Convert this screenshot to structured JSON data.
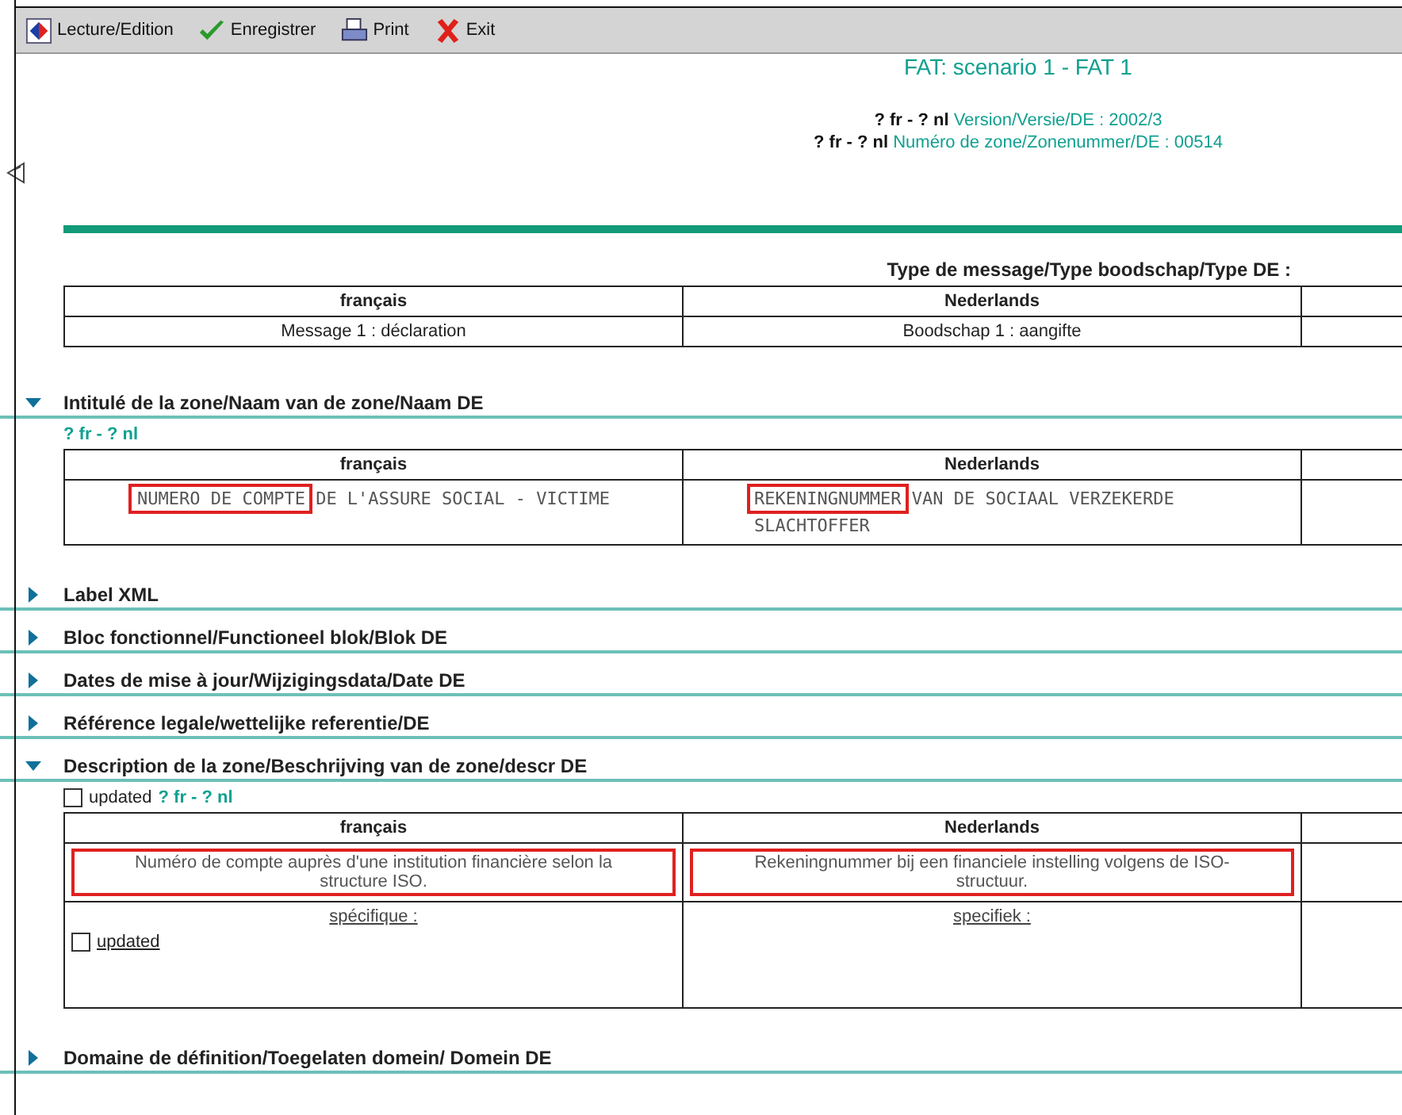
{
  "toolbar": [
    {
      "label": "Lecture/Edition"
    },
    {
      "label": "Enregistrer"
    },
    {
      "label": "Print"
    },
    {
      "label": "Exit"
    }
  ],
  "title": "FAT: scenario 1 - FAT 1",
  "meta": [
    {
      "prefix": "? fr - ? nl",
      "text": "Version/Versie/DE : 2002/3"
    },
    {
      "prefix": "? fr - ? nl",
      "text": "Numéro de zone/Zonenummer/DE : 00514"
    }
  ],
  "message_type": {
    "heading": "Type de message/Type boodschap/Type DE :",
    "columns": [
      "français",
      "Nederlands"
    ],
    "rows": [
      {
        "cells": [
          "Message 1 : déclaration",
          "Boodschap 1 : aangifte"
        ]
      }
    ]
  },
  "sections": [
    {
      "title": "Intitulé de la zone/Naam van de zone/Naam DE",
      "expanded": true,
      "lang_note": "? fr - ? nl",
      "table": {
        "columns": [
          "français",
          "Nederlands"
        ],
        "rows": [
          {
            "kind": "caps",
            "highlighted": true,
            "cells": [
              "NUMERO DE COMPTE DE L'ASSURE SOCIAL - VICTIME",
              "REKENINGNUMMER VAN DE SOCIAAL VERZEKERDE SLACHTOFFER"
            ]
          }
        ]
      }
    },
    {
      "title": "Label XML",
      "expanded": false
    },
    {
      "title": "Bloc fonctionnel/Functioneel blok/Blok DE",
      "expanded": false
    },
    {
      "title": "Dates de mise à jour/Wijzigingsdata/Date DE",
      "expanded": false
    },
    {
      "title": "Référence legale/wettelijke referentie/DE",
      "expanded": false
    },
    {
      "title": "Description de la zone/Beschrijving van de zone/descr DE",
      "expanded": true,
      "updated": {
        "label": "updated",
        "checked": false
      },
      "lang_note": "? fr -  ? nl",
      "table": {
        "columns": [
          "français",
          "Nederlands"
        ],
        "rows": [
          {
            "kind": "text",
            "highlighted": true,
            "cells": [
              "Numéro de compte auprès d'une institution financière selon la structure ISO.",
              "Rekeningnummer bij een financiele instelling volgens de ISO-structuur."
            ]
          },
          {
            "kind": "specific",
            "cells": [
              "spécifique :",
              "specifiek :"
            ],
            "updated": {
              "label": "updated",
              "checked": false
            }
          }
        ]
      }
    },
    {
      "title": "Domaine de définition/Toegelaten domein/ Domein DE",
      "expanded": false
    }
  ]
}
